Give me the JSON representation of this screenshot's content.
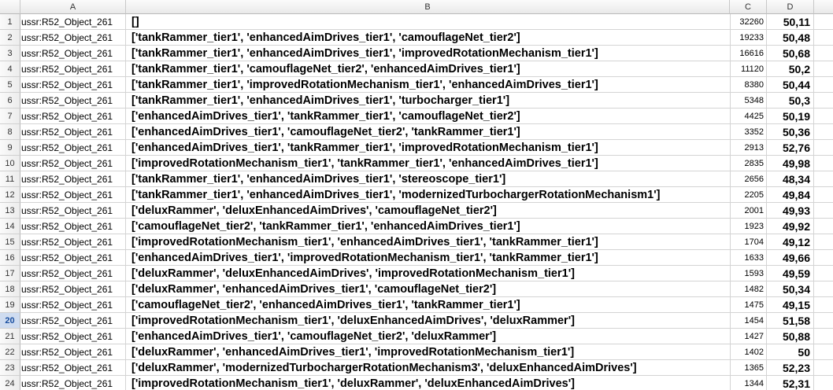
{
  "columns": [
    "A",
    "B",
    "C",
    "D"
  ],
  "active_row": 20,
  "rows": [
    {
      "n": "1",
      "a": "ussr:R52_Object_261",
      "b": "[]",
      "c": "32260",
      "d": "50,11"
    },
    {
      "n": "2",
      "a": "ussr:R52_Object_261",
      "b": "['tankRammer_tier1',  'enhancedAimDrives_tier1',  'camouflageNet_tier2']",
      "c": "19233",
      "d": "50,48"
    },
    {
      "n": "3",
      "a": "ussr:R52_Object_261",
      "b": "['tankRammer_tier1',  'enhancedAimDrives_tier1',  'improvedRotationMechanism_tier1']",
      "c": "16616",
      "d": "50,68"
    },
    {
      "n": "4",
      "a": "ussr:R52_Object_261",
      "b": "['tankRammer_tier1',  'camouflageNet_tier2',  'enhancedAimDrives_tier1']",
      "c": "11120",
      "d": "50,2"
    },
    {
      "n": "5",
      "a": "ussr:R52_Object_261",
      "b": "['tankRammer_tier1',  'improvedRotationMechanism_tier1',  'enhancedAimDrives_tier1']",
      "c": "8380",
      "d": "50,44"
    },
    {
      "n": "6",
      "a": "ussr:R52_Object_261",
      "b": "['tankRammer_tier1',  'enhancedAimDrives_tier1',  'turbocharger_tier1']",
      "c": "5348",
      "d": "50,3"
    },
    {
      "n": "7",
      "a": "ussr:R52_Object_261",
      "b": "['enhancedAimDrives_tier1',  'tankRammer_tier1',  'camouflageNet_tier2']",
      "c": "4425",
      "d": "50,19"
    },
    {
      "n": "8",
      "a": "ussr:R52_Object_261",
      "b": "['enhancedAimDrives_tier1',  'camouflageNet_tier2',  'tankRammer_tier1']",
      "c": "3352",
      "d": "50,36"
    },
    {
      "n": "9",
      "a": "ussr:R52_Object_261",
      "b": "['enhancedAimDrives_tier1',  'tankRammer_tier1',  'improvedRotationMechanism_tier1']",
      "c": "2913",
      "d": "52,76"
    },
    {
      "n": "10",
      "a": "ussr:R52_Object_261",
      "b": "['improvedRotationMechanism_tier1',  'tankRammer_tier1',  'enhancedAimDrives_tier1']",
      "c": "2835",
      "d": "49,98"
    },
    {
      "n": "11",
      "a": "ussr:R52_Object_261",
      "b": "['tankRammer_tier1',  'enhancedAimDrives_tier1',  'stereoscope_tier1']",
      "c": "2656",
      "d": "48,34"
    },
    {
      "n": "12",
      "a": "ussr:R52_Object_261",
      "b": "['tankRammer_tier1',  'enhancedAimDrives_tier1',  'modernizedTurbochargerRotationMechanism1']",
      "c": "2205",
      "d": "49,84"
    },
    {
      "n": "13",
      "a": "ussr:R52_Object_261",
      "b": "['deluxRammer',  'deluxEnhancedAimDrives',  'camouflageNet_tier2']",
      "c": "2001",
      "d": "49,93"
    },
    {
      "n": "14",
      "a": "ussr:R52_Object_261",
      "b": "['camouflageNet_tier2',  'tankRammer_tier1',  'enhancedAimDrives_tier1']",
      "c": "1923",
      "d": "49,92"
    },
    {
      "n": "15",
      "a": "ussr:R52_Object_261",
      "b": "['improvedRotationMechanism_tier1',  'enhancedAimDrives_tier1',  'tankRammer_tier1']",
      "c": "1704",
      "d": "49,12"
    },
    {
      "n": "16",
      "a": "ussr:R52_Object_261",
      "b": "['enhancedAimDrives_tier1',  'improvedRotationMechanism_tier1',  'tankRammer_tier1']",
      "c": "1633",
      "d": "49,66"
    },
    {
      "n": "17",
      "a": "ussr:R52_Object_261",
      "b": "['deluxRammer',  'deluxEnhancedAimDrives',  'improvedRotationMechanism_tier1']",
      "c": "1593",
      "d": "49,59"
    },
    {
      "n": "18",
      "a": "ussr:R52_Object_261",
      "b": "['deluxRammer',  'enhancedAimDrives_tier1',  'camouflageNet_tier2']",
      "c": "1482",
      "d": "50,34"
    },
    {
      "n": "19",
      "a": "ussr:R52_Object_261",
      "b": "['camouflageNet_tier2',  'enhancedAimDrives_tier1',  'tankRammer_tier1']",
      "c": "1475",
      "d": "49,15"
    },
    {
      "n": "20",
      "a": "ussr:R52_Object_261",
      "b": "['improvedRotationMechanism_tier1',  'deluxEnhancedAimDrives',  'deluxRammer']",
      "c": "1454",
      "d": "51,58"
    },
    {
      "n": "21",
      "a": "ussr:R52_Object_261",
      "b": "['enhancedAimDrives_tier1',  'camouflageNet_tier2',  'deluxRammer']",
      "c": "1427",
      "d": "50,88"
    },
    {
      "n": "22",
      "a": "ussr:R52_Object_261",
      "b": "['deluxRammer',  'enhancedAimDrives_tier1',  'improvedRotationMechanism_tier1']",
      "c": "1402",
      "d": "50"
    },
    {
      "n": "23",
      "a": "ussr:R52_Object_261",
      "b": "['deluxRammer',  'modernizedTurbochargerRotationMechanism3',  'deluxEnhancedAimDrives']",
      "c": "1365",
      "d": "52,23"
    },
    {
      "n": "24",
      "a": "ussr:R52_Object_261",
      "b": "['improvedRotationMechanism_tier1',  'deluxRammer',  'deluxEnhancedAimDrives']",
      "c": "1344",
      "d": "52,31"
    }
  ]
}
